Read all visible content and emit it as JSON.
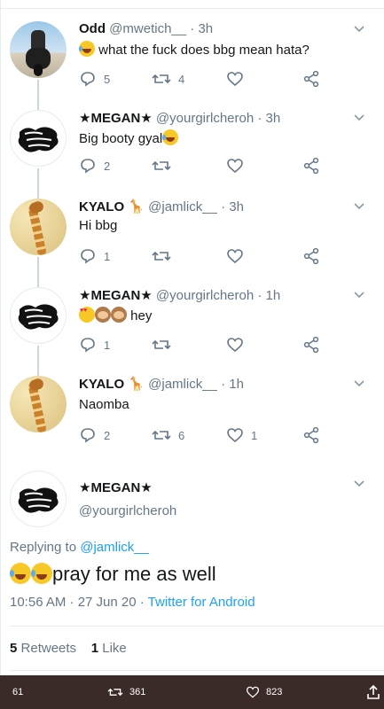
{
  "thread": [
    {
      "name": "Odd",
      "handle": "@mwetich__",
      "time": "3h",
      "text": "what the fuck does bbg mean hata?",
      "lead_emoji": "face-with-tears-of-joy",
      "replies": "5",
      "retweets": "4",
      "likes": ""
    },
    {
      "name": "★MEGAN★",
      "handle": "@yourgirlcheroh",
      "time": "3h",
      "text": "Big booty gyal",
      "trail_emoji": "face-with-tears-of-joy",
      "replies": "2",
      "retweets": "",
      "likes": ""
    },
    {
      "name": "KYALO",
      "name_emoji": "🦒",
      "handle": "@jamlick__",
      "time": "3h",
      "text": "Hi bbg",
      "replies": "1",
      "retweets": "",
      "likes": ""
    },
    {
      "name": "★MEGAN★",
      "handle": "@yourgirlcheroh",
      "time": "1h",
      "text": "hey",
      "lead_emojis": [
        "heart-eyes",
        "see-no-evil-monkey",
        "see-no-evil-monkey"
      ],
      "replies": "1",
      "retweets": "",
      "likes": ""
    },
    {
      "name": "KYALO",
      "name_emoji": "🦒",
      "handle": "@jamlick__",
      "time": "1h",
      "text": "Naomba",
      "replies": "2",
      "retweets": "6",
      "likes": "1"
    }
  ],
  "main_tweet": {
    "name": "★MEGAN★",
    "handle": "@yourgirlcheroh",
    "replying_prefix": "Replying to",
    "replying_to": "@jamlick__",
    "text": "pray for me as well",
    "timestamp": "10:56 AM · 27 Jun 20 ·",
    "source": "Twitter for Android",
    "retweets_count": "5",
    "retweets_label": "Retweets",
    "likes_count": "1",
    "likes_label": "Like"
  },
  "bottom_bar": {
    "replies": "61",
    "retweets": "361",
    "likes": "823"
  },
  "colors": {
    "accent": "#1da1f2",
    "muted": "#657786",
    "text": "#14171a",
    "divider": "#e6ecf0",
    "bottom_bar_bg": "#3b2b28"
  },
  "icons": {
    "reply": "reply-icon",
    "retweet": "retweet-icon",
    "like": "heart-icon",
    "share": "share-icon",
    "menu": "chevron-down-icon",
    "upload": "upload-icon"
  }
}
